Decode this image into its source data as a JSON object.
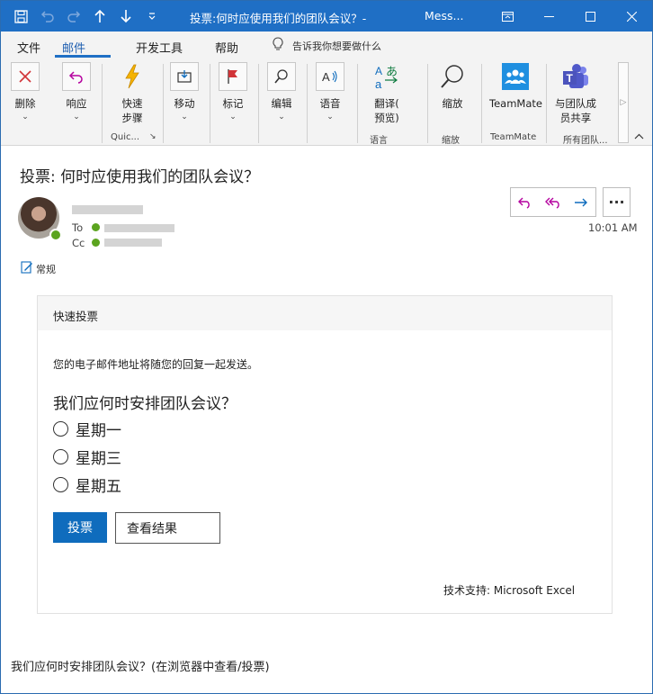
{
  "window": {
    "title": "投票:何时应使用我们的团队会议？-",
    "app_name": "Mess..."
  },
  "menu": {
    "tabs": [
      "文件",
      "邮件",
      "开发工具",
      "帮助"
    ],
    "active_tab": "邮件",
    "tell_me": "告诉我你想要做什么"
  },
  "ribbon": {
    "delete": "删除",
    "respond": "响应",
    "quick_steps_1": "快速",
    "quick_steps_2": "步骤",
    "quick_group": "Quic...",
    "move": "移动",
    "tags": "标记",
    "editing": "编辑",
    "speech": "语音",
    "translate_1": "翻译(",
    "translate_2": "预览)",
    "speech_group": "语言",
    "zoom": "缩放",
    "zoom_group": "缩放",
    "teammate": "TeamMate",
    "teammate_group": "TeamMate",
    "share_teams_1": "与团队成",
    "share_teams_2": "员共享",
    "all_teams_group": "所有团队...",
    "scroll_more": "▷"
  },
  "message": {
    "subject": "投票: 何时应使用我们的团队会议？",
    "to_label": "To",
    "cc_label": "Cc",
    "time": "10:01 AM",
    "sensitivity": "常规",
    "more": "···"
  },
  "poll": {
    "card_title": "快速投票",
    "note": "您的电子邮件地址将随您的回复一起发送。",
    "question": "我们应何时安排团队会议？",
    "options": [
      "星期一",
      "星期三",
      "星期五"
    ],
    "vote_label": "投票",
    "results_label": "查看结果",
    "powered_by": "技术支持: Microsoft Excel"
  },
  "footer": {
    "link_text": "我们应何时安排团队会议？(在浏览器中查看/投票)"
  },
  "colors": {
    "titlebar": "#1f6fc5",
    "accent": "#0f6cbd",
    "presence": "#5ba41f",
    "reply_arrow": "#b4009e",
    "forward_arrow": "#0f6cbd"
  }
}
